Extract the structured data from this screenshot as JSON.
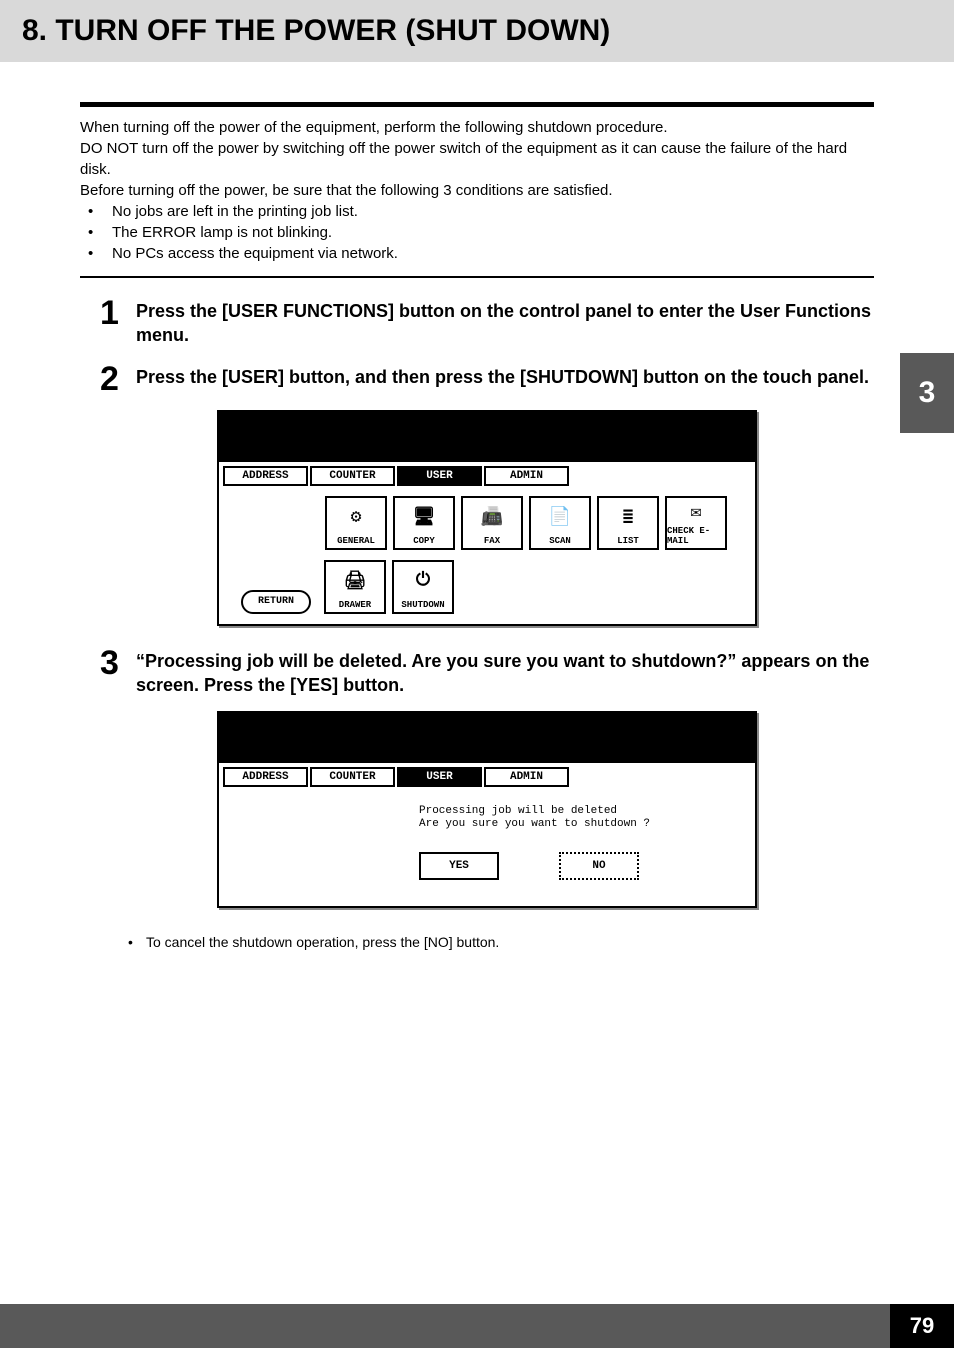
{
  "header": {
    "title": "8. TURN OFF THE POWER (SHUT DOWN)"
  },
  "intro": {
    "p1": "When turning off the power of the equipment, perform the following shutdown procedure.",
    "p2": "DO NOT turn off the power by switching off the power switch of the equipment as it can cause the failure of the hard disk.",
    "p3": "Before turning off the power, be sure that the following 3 conditions are satisfied.",
    "b1": "No jobs are left in the printing job list.",
    "b2": "The ERROR lamp is not blinking.",
    "b3": "No PCs access the equipment via network."
  },
  "steps": {
    "s1": {
      "num": "1",
      "text": "Press the [USER FUNCTIONS] button on the control panel to enter the User Functions menu."
    },
    "s2": {
      "num": "2",
      "text": "Press the [USER] button, and then press the [SHUTDOWN] button on the touch panel."
    },
    "s3": {
      "num": "3",
      "text": "“Processing job will be deleted. Are you sure you want to shutdown?” appears on the screen. Press the [YES] button."
    }
  },
  "touchpanel1": {
    "tabs": {
      "t1": "ADDRESS",
      "t2": "COUNTER",
      "t3": "USER",
      "t4": "ADMIN"
    },
    "row1": {
      "b1": "GENERAL",
      "b2": "COPY",
      "b3": "FAX",
      "b4": "SCAN",
      "b5": "LIST",
      "b6": "CHECK E-MAIL"
    },
    "row2": {
      "b1": "DRAWER",
      "b2": "SHUTDOWN"
    },
    "return": "RETURN"
  },
  "touchpanel2": {
    "tabs": {
      "t1": "ADDRESS",
      "t2": "COUNTER",
      "t3": "USER",
      "t4": "ADMIN"
    },
    "msg1": "Processing job will be deleted",
    "msg2": "Are you sure you want to shutdown ?",
    "yes": "YES",
    "no": "NO"
  },
  "note": {
    "n1": "To cancel the shutdown operation, press the [NO] button."
  },
  "sidebar": {
    "chapter": "3"
  },
  "footer": {
    "page": "79"
  }
}
